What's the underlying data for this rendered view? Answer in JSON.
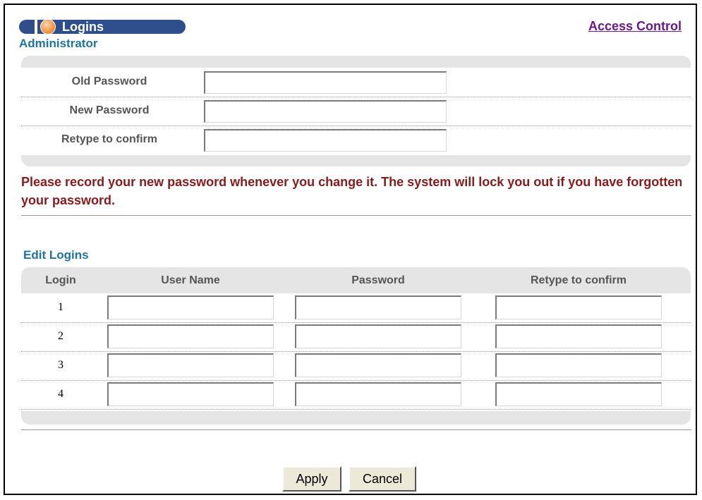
{
  "header": {
    "title": "Logins",
    "link": "Access Control"
  },
  "administrator": {
    "section_title": "Administrator",
    "fields": [
      {
        "label": "Old Password",
        "value": ""
      },
      {
        "label": "New Password",
        "value": ""
      },
      {
        "label": "Retype to confirm",
        "value": ""
      }
    ]
  },
  "warning": "Please record your new password whenever you change it. The system will lock you out if you have forgotten your password.",
  "edit_logins": {
    "section_title": "Edit Logins",
    "columns": [
      "Login",
      "User Name",
      "Password",
      "Retype to confirm"
    ],
    "rows": [
      {
        "login": "1",
        "user_name": "",
        "password": "",
        "retype": ""
      },
      {
        "login": "2",
        "user_name": "",
        "password": "",
        "retype": ""
      },
      {
        "login": "3",
        "user_name": "",
        "password": "",
        "retype": ""
      },
      {
        "login": "4",
        "user_name": "",
        "password": "",
        "retype": ""
      }
    ]
  },
  "buttons": {
    "apply": "Apply",
    "cancel": "Cancel"
  },
  "colors": {
    "title_pill": "#2e4f8c",
    "section_title": "#1f73a3",
    "warning": "#8b1a1a",
    "link": "#6a1a8a"
  }
}
